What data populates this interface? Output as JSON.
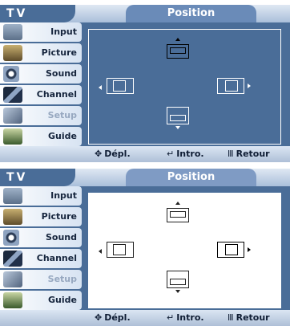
{
  "screens": [
    {
      "tv_label": "TV",
      "title": "Position",
      "menu": [
        {
          "label": "Input",
          "icon": "input-icon"
        },
        {
          "label": "Picture",
          "icon": "picture-icon"
        },
        {
          "label": "Sound",
          "icon": "sound-icon"
        },
        {
          "label": "Channel",
          "icon": "channel-icon"
        },
        {
          "label": "Setup",
          "icon": "setup-icon"
        },
        {
          "label": "Guide",
          "icon": "guide-icon"
        }
      ],
      "footer": {
        "move": "Dépl.",
        "enter": "Intro.",
        "return": "Retour"
      },
      "selected_direction": "up"
    },
    {
      "tv_label": "TV",
      "title": "Position",
      "menu": [
        {
          "label": "Input",
          "icon": "input-icon"
        },
        {
          "label": "Picture",
          "icon": "picture-icon"
        },
        {
          "label": "Sound",
          "icon": "sound-icon"
        },
        {
          "label": "Channel",
          "icon": "channel-icon"
        },
        {
          "label": "Setup",
          "icon": "setup-icon"
        },
        {
          "label": "Guide",
          "icon": "guide-icon"
        }
      ],
      "footer": {
        "move": "Dépl.",
        "enter": "Intro.",
        "return": "Retour"
      },
      "selected_direction": "right"
    }
  ]
}
